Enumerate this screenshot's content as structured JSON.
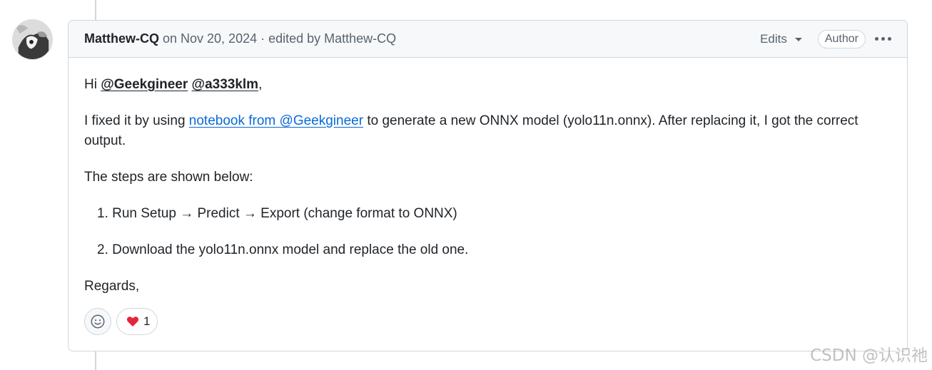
{
  "comment": {
    "author": "Matthew-CQ",
    "header_text": "on Nov 20, 2024 · edited by Matthew-CQ",
    "edits_label": "Edits",
    "badge": "Author"
  },
  "body": {
    "greeting_prefix": "Hi ",
    "mention_1": "@Geekgineer",
    "mention_2": "@a333klm",
    "greeting_suffix": ",",
    "p2_prefix": "I fixed it by using ",
    "p2_link": "notebook from @Geekgineer",
    "p2_suffix": " to generate a new ONNX model (yolo11n.onnx). After replacing it, I got the correct output.",
    "p3": "The steps are shown below:",
    "steps": [
      "1. Run Setup → Predict → Export (change format to ONNX)",
      "2. Download the yolo11n.onnx model and replace the old one."
    ],
    "signoff": "Regards,"
  },
  "reactions": {
    "heart_count": "1"
  },
  "icons": {
    "add_reaction": "smiley-icon",
    "heart": "heart-icon",
    "menu": "kebab-icon",
    "dropdown": "chevron-down-icon"
  },
  "colors": {
    "link": "#0969da",
    "heart": "#e5253a",
    "border": "#d0d7de"
  },
  "watermark": "CSDN @认识祂"
}
